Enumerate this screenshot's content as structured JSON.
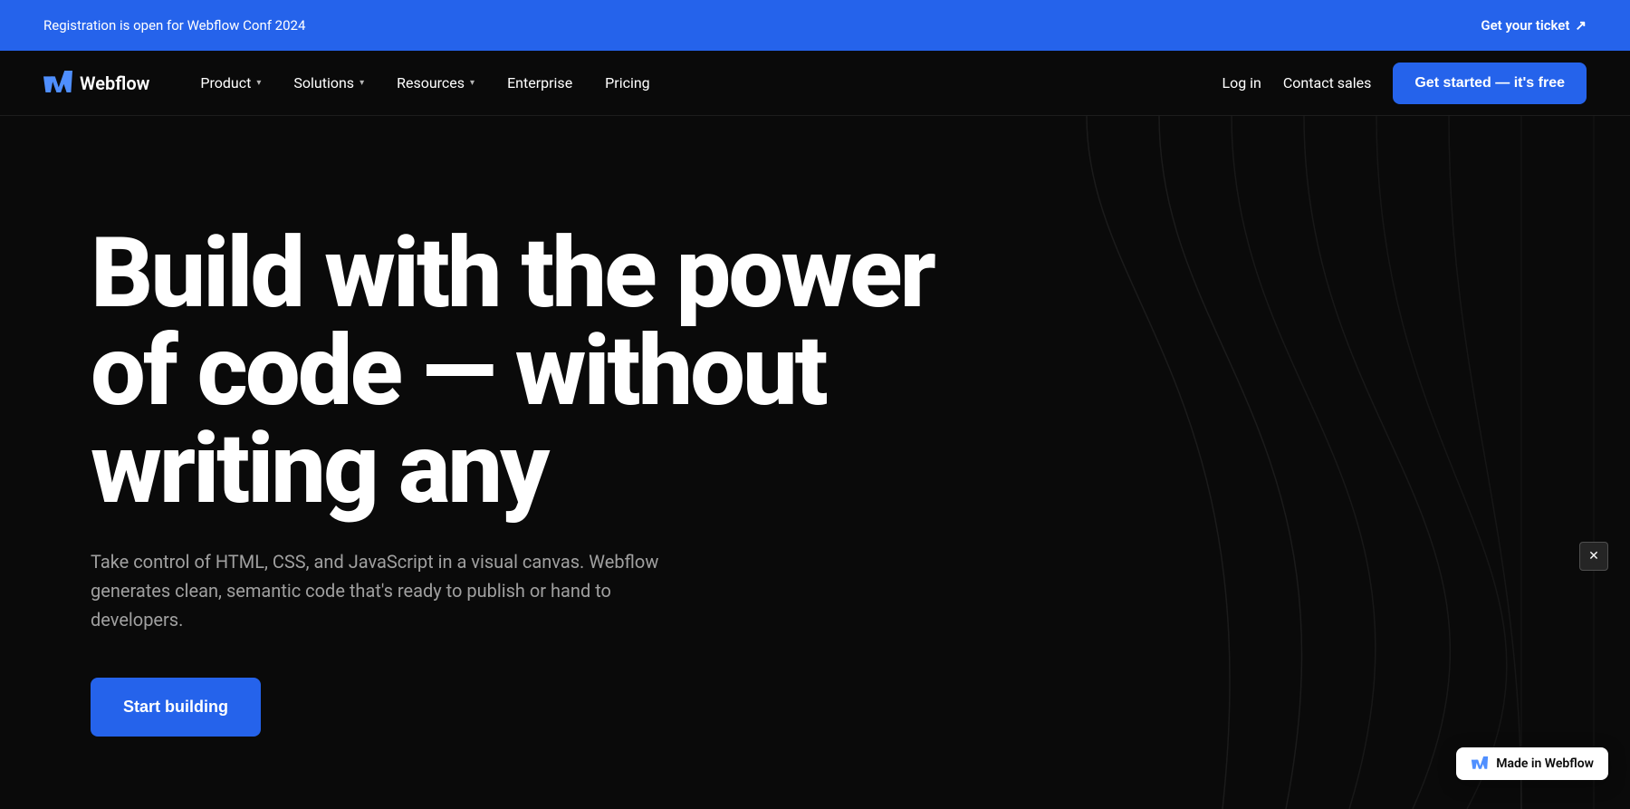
{
  "announcement": {
    "text": "Registration is open for Webflow Conf 2024",
    "link_text": "Get your ticket",
    "link_icon": "↗"
  },
  "navbar": {
    "logo_text": "Webflow",
    "links": [
      {
        "label": "Product",
        "has_dropdown": true
      },
      {
        "label": "Solutions",
        "has_dropdown": true
      },
      {
        "label": "Resources",
        "has_dropdown": true
      },
      {
        "label": "Enterprise",
        "has_dropdown": false
      },
      {
        "label": "Pricing",
        "has_dropdown": false
      }
    ],
    "login_label": "Log in",
    "contact_label": "Contact sales",
    "cta_label": "Get started — it's free"
  },
  "hero": {
    "title_line1": "Build with the power",
    "title_line2": "of code — without",
    "title_line3": "writing any",
    "subtitle": "Take control of HTML, CSS, and JavaScript in a visual canvas. Webflow generates clean, semantic code that's ready to publish or hand to developers.",
    "cta_label": "Start building"
  },
  "made_in_webflow": {
    "label": "Made in Webflow"
  },
  "colors": {
    "brand_blue": "#2563eb",
    "bg_dark": "#0a0a0a",
    "text_white": "#ffffff",
    "text_muted": "#a0a0a0"
  }
}
